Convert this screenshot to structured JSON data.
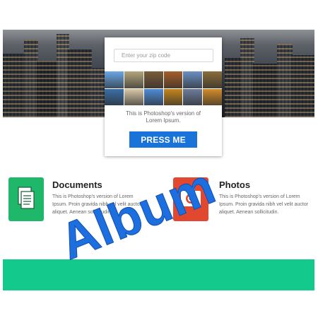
{
  "hero": {
    "scene": "city skyline"
  },
  "card": {
    "zip_placeholder": "Enter your zip code",
    "caption_line1": "This is Photoshop's version of",
    "caption_line2": "Lorem Ipsum.",
    "button_label": "PRESS ME",
    "thumb_colors": [
      "#6aa7e6",
      "#b3a57d",
      "#7a5d3b",
      "#a65f2a",
      "#6a8fc2",
      "#8a6d3a",
      "#3b6ea7",
      "#d7c7a6",
      "#4f8bd6",
      "#c4851e",
      "#6d7c9b",
      "#d28c2b"
    ]
  },
  "features": {
    "documents": {
      "title": "Documents",
      "text_line1": "This is Photoshop's version of Lorem",
      "text_line2": "Ipsum. Proin gravida nibh vel velit auctor",
      "text_line3": "aliquet. Aenean sollicitudin."
    },
    "photos": {
      "title": "Photos",
      "text_line1": "This is Photoshop's version of Lorem",
      "text_line2": "Ipsum. Proin gravida nibh vel velit auctor",
      "text_line3": "aliquet. Aenean sollicitudin."
    }
  },
  "overlay": {
    "word": "Album"
  },
  "colors": {
    "accent_blue": "#1a73d9",
    "green": "#14c98c",
    "doc_green": "#1fb86a",
    "photo_red": "#e2472f"
  }
}
